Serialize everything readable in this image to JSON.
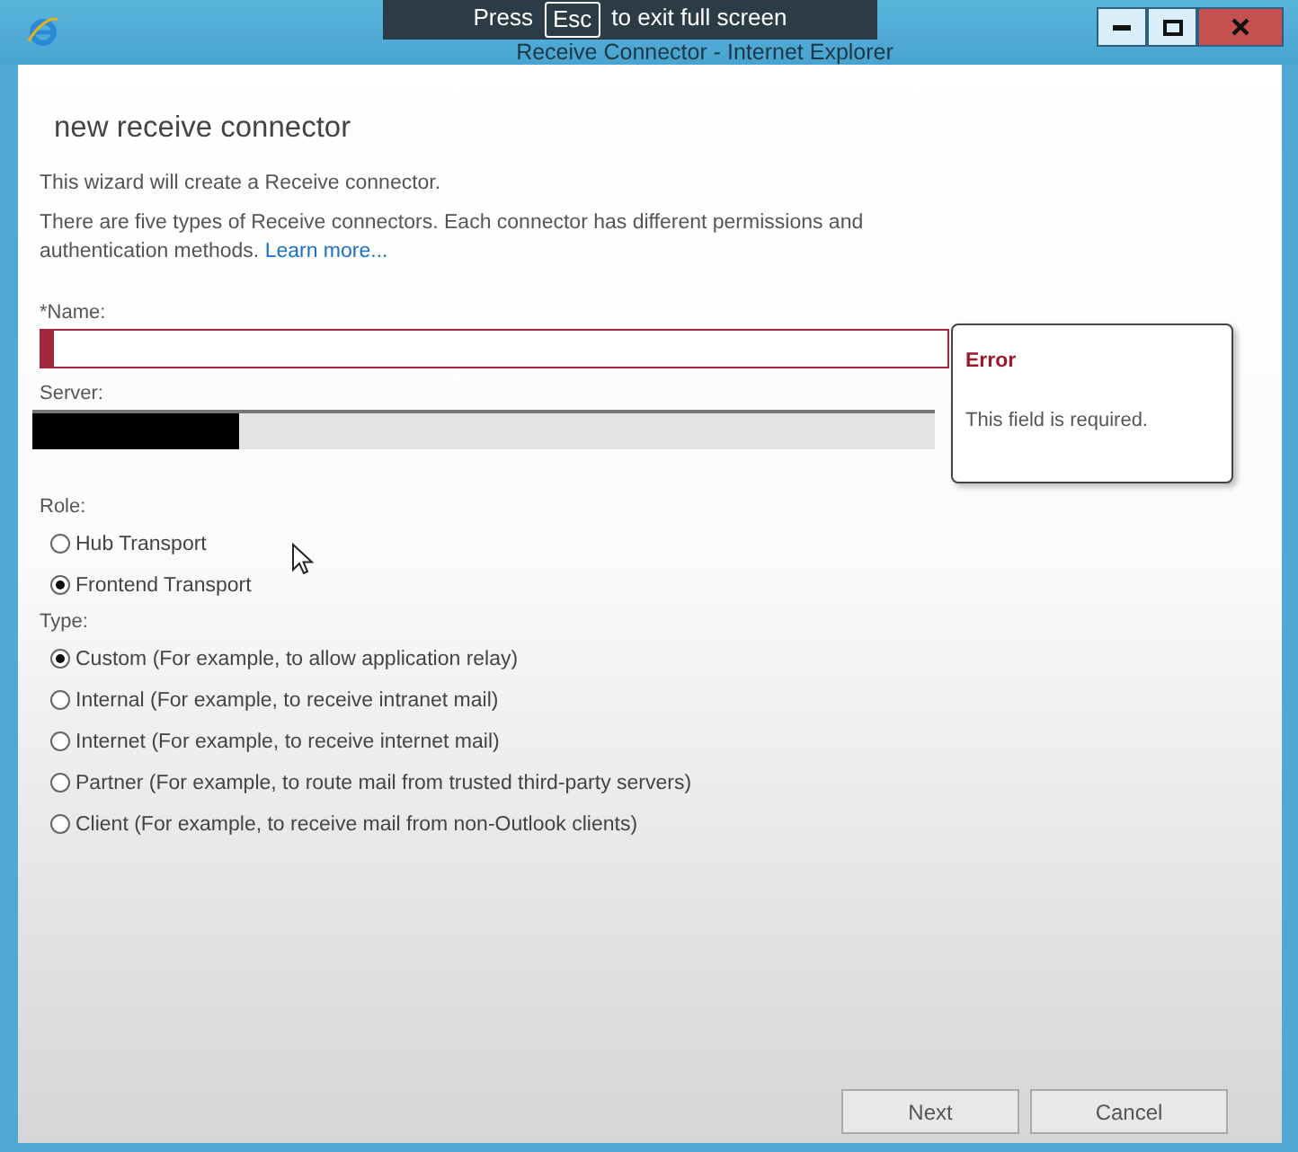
{
  "window": {
    "title": "Receive Connector - Internet Explorer",
    "fullscreen_notice": {
      "before": "Press",
      "key": "Esc",
      "after": "to exit full screen"
    }
  },
  "wizard": {
    "heading": "new receive connector",
    "intro": "This wizard will create a Receive connector.",
    "description": "There are five types of Receive connectors. Each connector has different permissions and authentication methods.",
    "learn_more": "Learn more...",
    "name_field": {
      "label": "*Name:",
      "error": true
    },
    "error_callout": {
      "title": "Error",
      "message": "This field is required."
    },
    "server_field": {
      "label": "Server:"
    },
    "role": {
      "label": "Role:",
      "options": [
        {
          "label": "Hub Transport",
          "selected": false
        },
        {
          "label": "Frontend Transport",
          "selected": true
        }
      ]
    },
    "type": {
      "label": "Type:",
      "options": [
        {
          "label": "Custom (For example, to allow application relay)",
          "selected": true
        },
        {
          "label": "Internal (For example, to receive intranet mail)",
          "selected": false
        },
        {
          "label": "Internet (For example, to receive internet mail)",
          "selected": false
        },
        {
          "label": "Partner (For example, to route mail from trusted third-party servers)",
          "selected": false
        },
        {
          "label": "Client (For example, to receive mail from non-Outlook clients)",
          "selected": false
        }
      ]
    },
    "buttons": [
      {
        "label": "Next"
      },
      {
        "label": "Cancel"
      }
    ]
  }
}
